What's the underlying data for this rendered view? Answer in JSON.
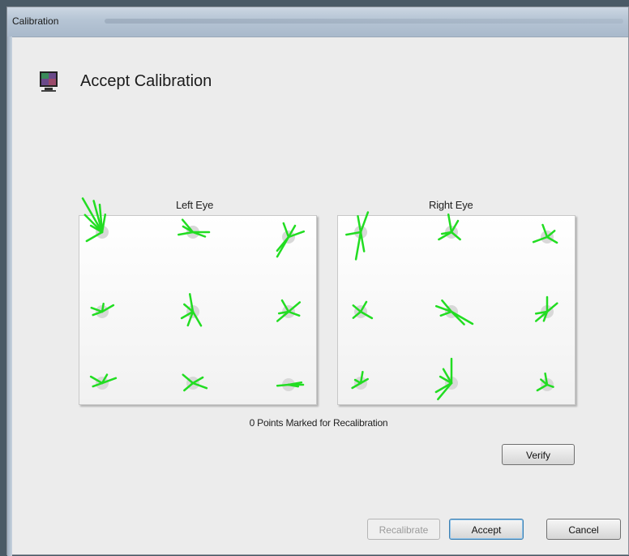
{
  "window": {
    "title": "Calibration"
  },
  "header": {
    "title": "Accept Calibration",
    "icon": "monitor-icon"
  },
  "panels": {
    "left_label": "Left Eye",
    "right_label": "Right Eye"
  },
  "status": {
    "text": "0 Points Marked for Recalibration"
  },
  "buttons": {
    "verify": "Verify",
    "recalibrate": "Recalibrate",
    "accept": "Accept",
    "cancel": "Cancel"
  },
  "colors": {
    "gaze_lines": "#22dd22",
    "target_dot": "#d8d8d8"
  }
}
